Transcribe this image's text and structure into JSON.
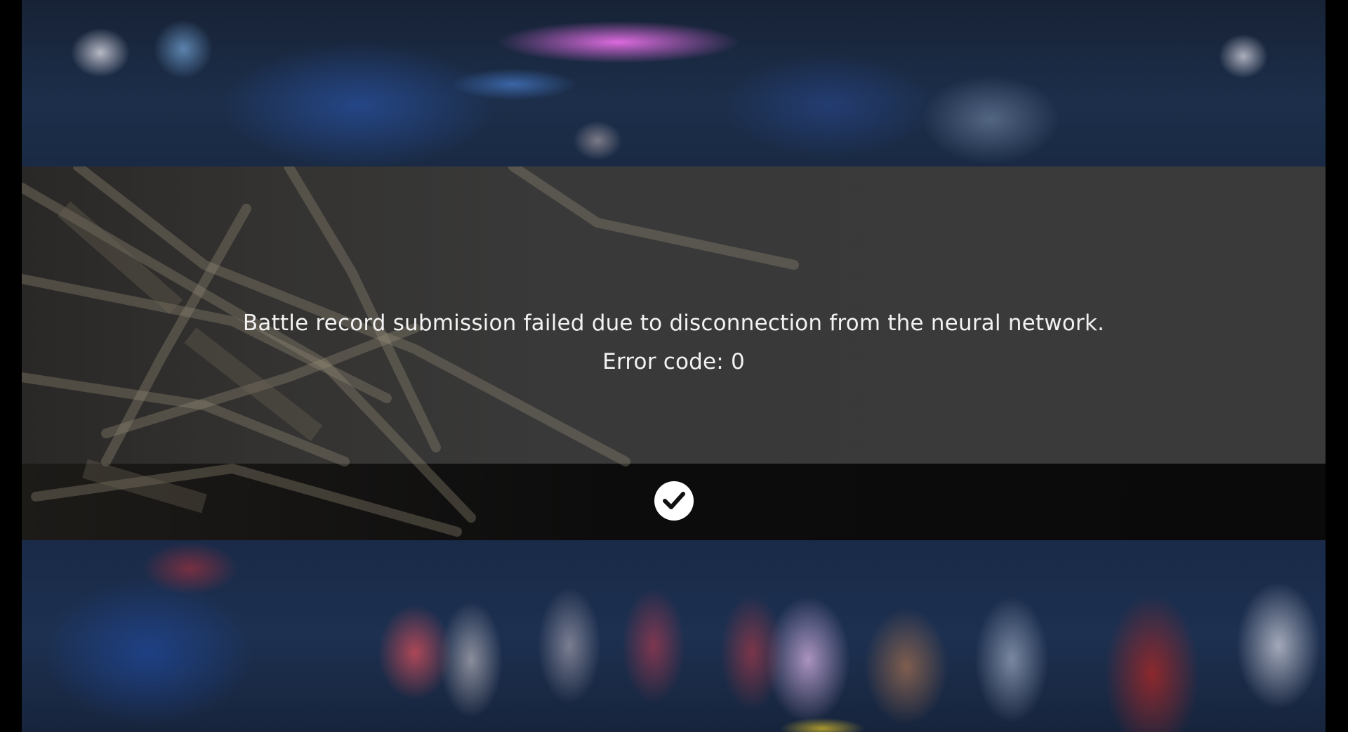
{
  "dialog": {
    "message": "Battle record submission failed due to disconnection from the neural network.",
    "error_code": "Error code: 0",
    "confirm_icon": "checkmark-icon"
  },
  "colors": {
    "panel": "#3a3a3a",
    "footer": "#0a0a0a",
    "text": "#f2f2f2",
    "button": "#ffffff"
  }
}
